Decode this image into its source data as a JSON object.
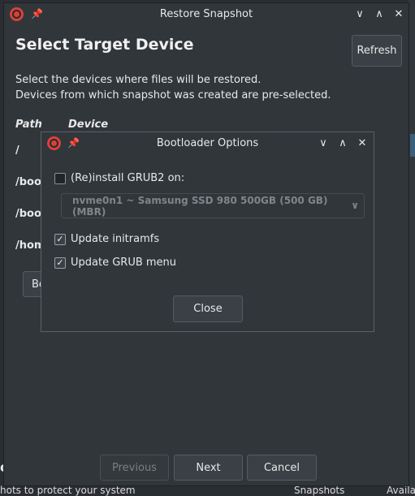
{
  "main_window": {
    "title": "Restore Snapshot",
    "heading": "Select Target Device",
    "refresh_label": "Refresh",
    "description_line1": "Select the devices where files will be restored.",
    "description_line2": "Devices from which snapshot was created are pre-selected.",
    "columns": {
      "path": "Path",
      "device": "Device"
    },
    "rows": [
      {
        "path": "/"
      },
      {
        "path": "/boot"
      },
      {
        "path": "/boot"
      },
      {
        "path": "/home"
      }
    ],
    "left_button_label": "Bo",
    "previous_label": "Previous",
    "next_label": "Next",
    "cancel_label": "Cancel"
  },
  "dialog": {
    "title": "Bootloader Options",
    "reinstall_label": "(Re)install GRUB2 on:",
    "reinstall_checked": false,
    "device_selected": "nvme0n1 ~ Samsung SSD 980 500GB (500 GB) (MBR)",
    "update_initramfs_label": "Update initramfs",
    "update_initramfs_checked": true,
    "update_grub_label": "Update GRUB menu",
    "update_grub_checked": true,
    "close_label": "Close"
  },
  "background": {
    "bottom_text_left": "hots to protect your system",
    "bottom_text_mid": "Snapshots",
    "bottom_text_right": "Availa",
    "left_char": "o"
  },
  "colors": {
    "window_bg": "#31363b",
    "app_icon": "#d8413a",
    "highlight": "#3a5f7a"
  }
}
